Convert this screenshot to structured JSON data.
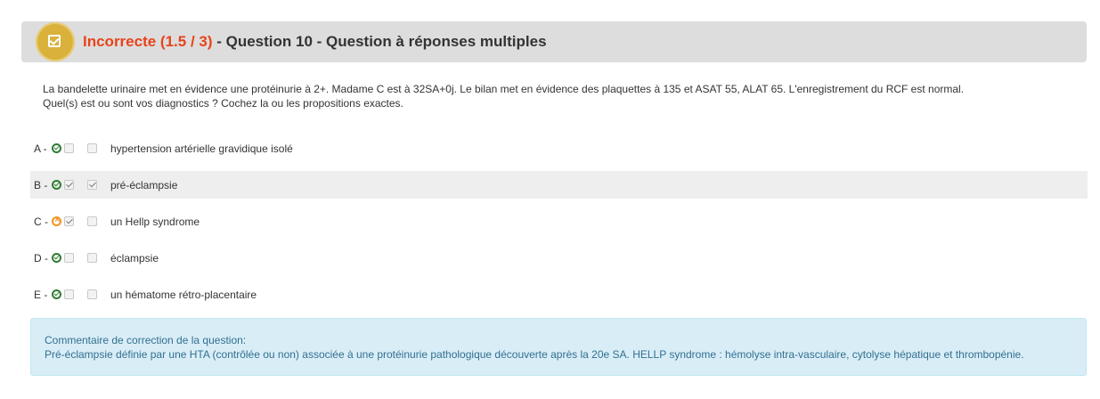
{
  "question": {
    "status": "Incorrecte (1.5 / 3)",
    "title": " - Question 10 - Question à réponses multiples",
    "icon": "checkbox-icon",
    "badge_color": "#d9b13b",
    "status_color": "#e8431b",
    "statement_line1": "La bandelette urinaire met en évidence une protéinurie à 2+. Madame C est à 32SA+0j. Le bilan met en évidence des plaquettes à 135 et ASAT 55, ALAT 65. L'enregistrement du RCF est normal.",
    "statement_line2": "Quel(s) est ou sont vos diagnostics ? Cochez la ou les propositions exactes."
  },
  "answers": [
    {
      "letter": "A -",
      "text": "hypertension artérielle gravidique isolé",
      "correct": true,
      "expected_checked": false,
      "user_checked": false,
      "highlight": false
    },
    {
      "letter": "B -",
      "text": "pré-éclampsie",
      "correct": true,
      "expected_checked": true,
      "user_checked": true,
      "highlight": true
    },
    {
      "letter": "C -",
      "text": "un Hellp syndrome",
      "correct": false,
      "expected_checked": true,
      "user_checked": false,
      "highlight": false
    },
    {
      "letter": "D -",
      "text": "éclampsie",
      "correct": true,
      "expected_checked": false,
      "user_checked": false,
      "highlight": false
    },
    {
      "letter": "E -",
      "text": "un hématome rétro-placentaire",
      "correct": true,
      "expected_checked": false,
      "user_checked": false,
      "highlight": false
    }
  ],
  "comment": {
    "title": "Commentaire de correction de la question:",
    "text": "Pré-éclampsie définie par une HTA (contrôlée ou non) associée à une protéinurie pathologique découverte après la 20e SA.  HELLP syndrome : hémolyse intra-vasculaire, cytolyse hépatique et thrombopénie."
  },
  "colors": {
    "header_bg": "#dddddd",
    "correct_mark": "#2e7d32",
    "wrong_mark": "#f0931f",
    "comment_bg": "#d9edf7",
    "comment_text": "#31708f"
  }
}
